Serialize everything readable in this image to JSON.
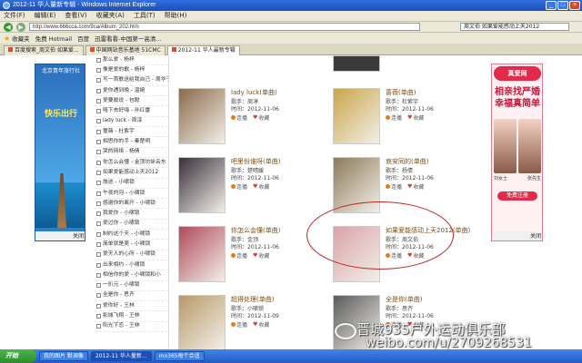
{
  "window": {
    "title": "2012-11 华人量新专辑 - Windows Internet Explorer"
  },
  "menu": [
    "文件(F)",
    "编辑(E)",
    "查看(V)",
    "收藏夹(A)",
    "工具(T)",
    "帮助(H)"
  ],
  "address": {
    "url": "http://www.666cca.com/9ca/Album_202.htm",
    "search": "周文伯 如果爱能感动上天2012"
  },
  "favbar": {
    "label": "收藏夹",
    "items": [
      "免费 Hotmail",
      "百度",
      "迅雷看看-中国第一高清..."
    ]
  },
  "tabs": [
    {
      "label": "百度搜索_周文伯 如果爱...",
      "active": false
    },
    {
      "label": "中国网站音乐基地 51CMC",
      "active": false
    },
    {
      "label": "2012-11 华人最新专辑",
      "active": true
    }
  ],
  "songlist": [
    "那么爱 - 杨梓",
    "像是爱的歌 - 杨梓",
    "写一首歌送给我自己 - 周华子",
    "爱你遇到晚 - 温婉",
    "爱要敢说 - 包聪",
    "嘻下去好嗨 - 孙红雷",
    "lady luck - 周淳",
    "蔷薇 - 杜紫宇",
    "相思你的手 - 秦楚明",
    "哭的网络 - 杨倩",
    "你怎么会懂 - 金顶坊徐云东",
    "如果爱能感动上天2012",
    "旅途 - 小啸锁",
    "午夜的河 - 小啸锁",
    "感谢你的离开 - 小啸锁",
    "我爱你 - 小啸锁",
    "爱过你 - 小啸锁",
    "制约这个天 - 小啸锁",
    "简单就是美 - 小啸锁",
    "爱天人的心所 - 小啸锁",
    "出来相约 - 小啸锁",
    "相信你的爱 - 小啸锁和小",
    "一扒元 - 小啸锁",
    "全是你 - 思齐",
    "爱你好 - 王林",
    "影城飞翔 - 王林",
    "阳光下恋 - 王林"
  ],
  "cards": [
    {
      "title": "lady luck(单曲)",
      "singer": "歌手：周淳",
      "date": "时间：2012-11-06",
      "cover": "#8a6a4a"
    },
    {
      "title": "蔷薇(单曲)",
      "singer": "歌手：杜紫宇",
      "date": "时间：2012-11-06",
      "cover": "#caa64a"
    },
    {
      "title": "吧里份谁呀(单曲)",
      "singer": "歌手：楚晴媛",
      "date": "时间：2012-11-06",
      "cover": "#3a2f3a"
    },
    {
      "title": "哀安同的(单曲)",
      "singer": "歌手：杨倩",
      "date": "时间：2012-11-06",
      "cover": "#8c7a5a"
    },
    {
      "title": "你怎么会懂(单曲)",
      "singer": "歌手：金顶",
      "date": "时间：2012-11-06",
      "cover": "#b04a5a"
    },
    {
      "title": "如果爱能感动上天2012(单曲)",
      "singer": "歌手：周文伯",
      "date": "时间：2012-11-06",
      "cover": "#d9a3a8"
    },
    {
      "title": "超得处理(单曲)",
      "singer": "歌手：小啸锁",
      "date": "时间：2012-11-09",
      "cover": "#b89a6a"
    },
    {
      "title": "全是你(单曲)",
      "singer": "歌手：思齐",
      "date": "时间：2012-11-06",
      "cover": "#5a5a5a"
    }
  ],
  "card_actions": {
    "play": "连播",
    "fav": "收藏"
  },
  "ads": {
    "left": {
      "top": "北京青年旅行社",
      "mid": "快乐出行",
      "close": "关闭"
    },
    "right": {
      "logo": "真爱网",
      "slogan": "相亲找严婚 幸福真简单",
      "names": [
        "刘女士",
        "张先生"
      ],
      "cta": "免费注册",
      "close": "关闭"
    }
  },
  "taskbar": {
    "start": "开始",
    "tasks": [
      {
        "label": "我的图片 默调像",
        "active": false
      },
      {
        "label": "2012-11 华人量新...",
        "active": true
      },
      {
        "label": "mo365每个合适",
        "active": false
      }
    ]
  },
  "watermark": {
    "line1": "晋城935户外运动俱乐部",
    "line2": "weibo.com/u/2709268531"
  }
}
